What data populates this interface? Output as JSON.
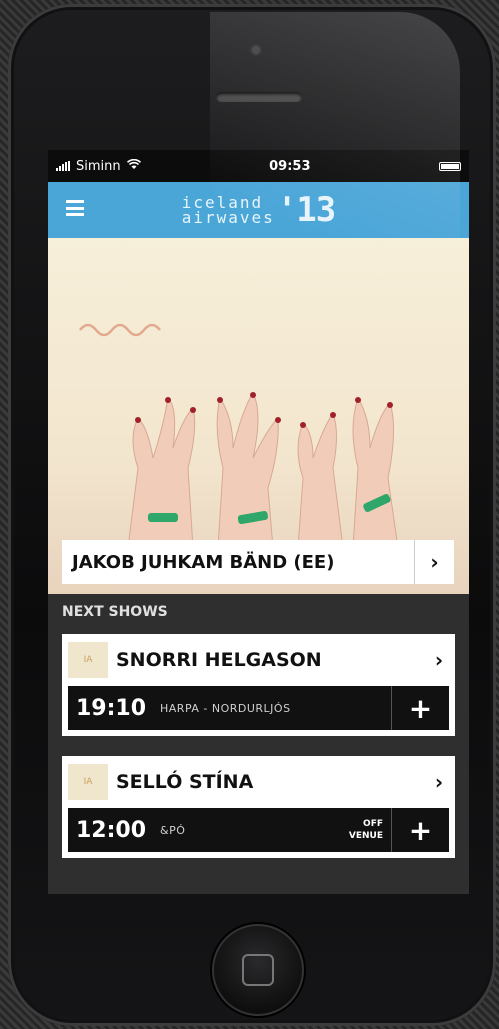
{
  "status_bar": {
    "carrier": "Siminn",
    "time": "09:53"
  },
  "header": {
    "logo_line1": "ICELAND",
    "logo_line2": "AIRWAVES",
    "logo_year": "'13",
    "accent_color": "#4ba6d8"
  },
  "featured": {
    "artist": "JAKOB JUHKAM BÄND (EE)",
    "arrow": "›"
  },
  "next_shows": {
    "title": "NEXT SHOWS",
    "shows": [
      {
        "name": "SNORRI HELGASON",
        "time": "19:10",
        "venue": "HARPA - NORDURLJÓS",
        "tag_line1": "",
        "tag_line2": "",
        "add_label": "+",
        "chevron": "›"
      },
      {
        "name": "SELLÓ STÍNA",
        "time": "12:00",
        "venue": "&PÓ",
        "tag_line1": "OFF",
        "tag_line2": "VENUE",
        "add_label": "+",
        "chevron": "›"
      }
    ]
  }
}
